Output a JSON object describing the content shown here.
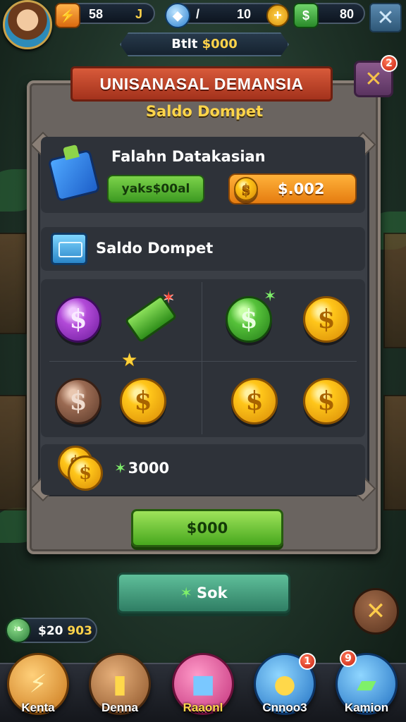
{
  "top_bar": {
    "resource_1": {
      "value": "58",
      "suffix": "J"
    },
    "resource_2": {
      "value_a": "/",
      "value_b": "10"
    },
    "resource_3": {
      "value": "80"
    },
    "banner": {
      "prefix": "Btlt",
      "amount": "$000"
    }
  },
  "panel": {
    "title": "UNISANASAL DEMANSIA",
    "subtitle": "Saldo Dompet",
    "badge_count": "2",
    "row1": {
      "title": "Falahn Datakasian",
      "green_label": "yaks$00al",
      "amount": "$.002"
    },
    "row2": {
      "label": "Saldo Dompet"
    },
    "coins_total": "3000",
    "confirm_button": "$000"
  },
  "sok_button": "Sok",
  "balance": {
    "prefix": "$20",
    "suffix": "903"
  },
  "bottom_nav": [
    {
      "label": "Kenta",
      "badge": ""
    },
    {
      "label": "Denna",
      "badge": ""
    },
    {
      "label": "Raaonl",
      "badge": ""
    },
    {
      "label": "Cnnoo3",
      "badge": "1"
    },
    {
      "label": "Kamion",
      "badge": "9"
    }
  ],
  "colors": {
    "title_ribbon": "#c0432a",
    "subtitle": "#ffd54a",
    "green_button": "#6cc83a",
    "orange_button": "#f59a22",
    "teal_button": "#3f9f7e"
  }
}
